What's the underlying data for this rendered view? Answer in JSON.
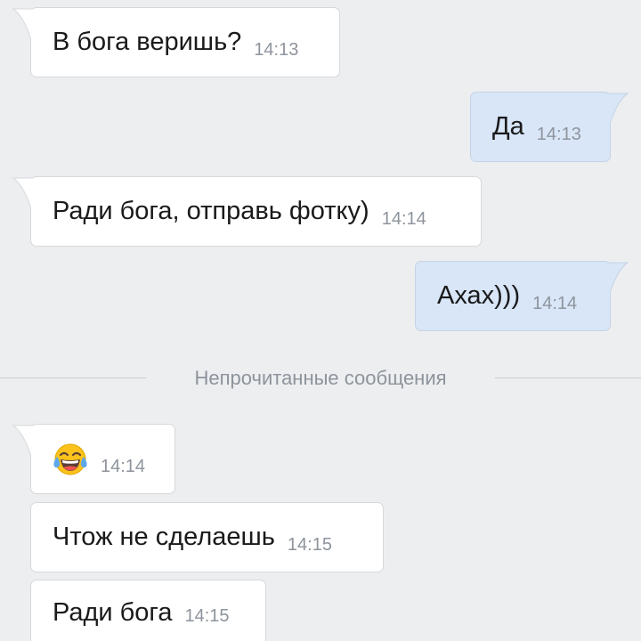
{
  "messages": [
    {
      "direction": "incoming",
      "text": "В бога веришь?",
      "time": "14:13"
    },
    {
      "direction": "outgoing",
      "text": "Да",
      "time": "14:13"
    },
    {
      "direction": "incoming",
      "text": "Ради бога, отправь фотку)",
      "time": "14:14"
    },
    {
      "direction": "outgoing",
      "text": "Ахах)))",
      "time": "14:14"
    },
    {
      "direction": "incoming",
      "emoji": "face-with-tears-of-joy-emoji",
      "time": "14:14"
    },
    {
      "direction": "incoming",
      "text": "Чтож не сделаешь",
      "time": "14:15"
    },
    {
      "direction": "incoming",
      "text": "Ради бога",
      "time": "14:15"
    }
  ],
  "divider": {
    "label": "Непрочитанные сообщения"
  },
  "colors": {
    "background": "#edeef0",
    "incoming_bubble": "#ffffff",
    "outgoing_bubble": "#d8e6f8",
    "time_text": "#8e949c"
  }
}
